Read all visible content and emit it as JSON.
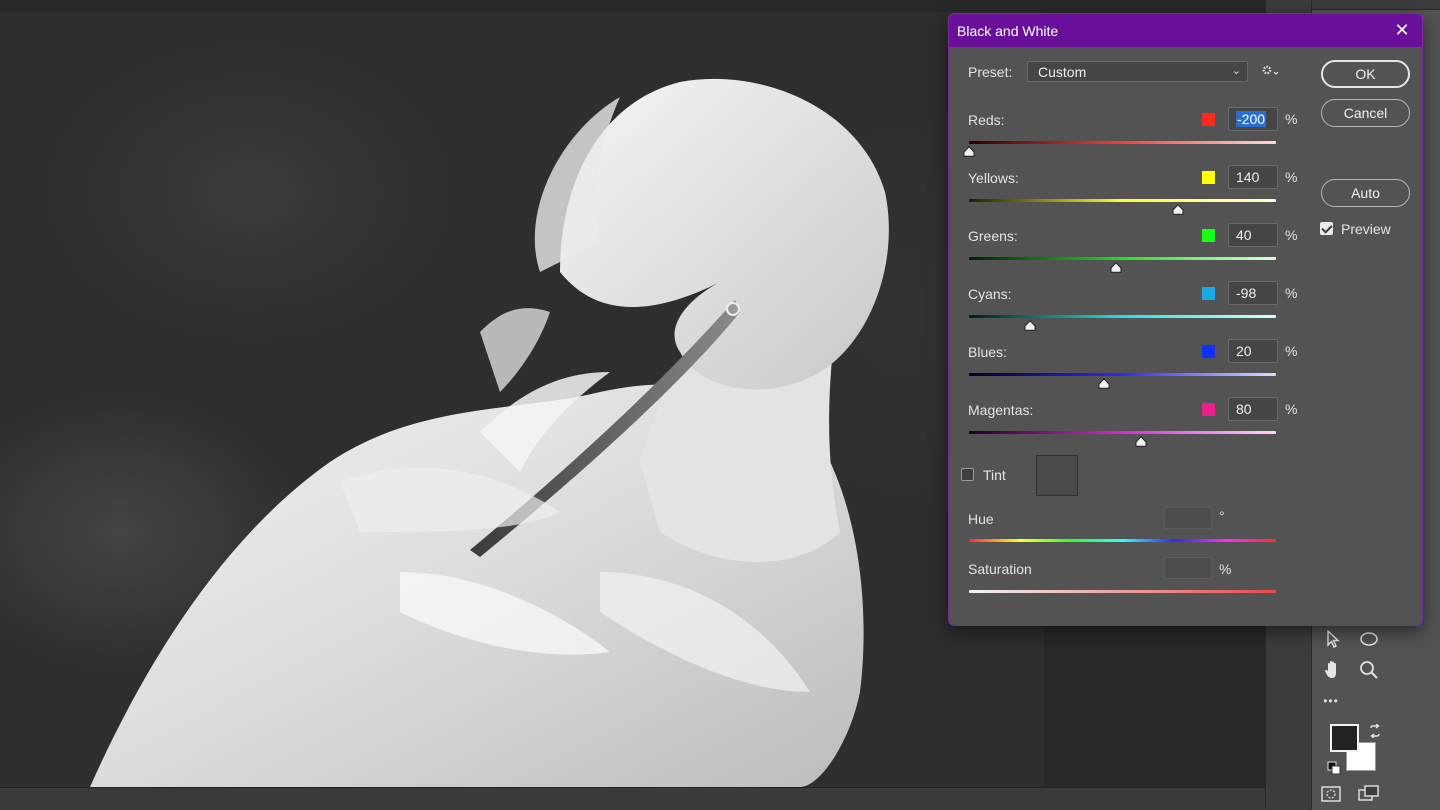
{
  "dialog": {
    "title": "Black and White",
    "close_glyph": "✕",
    "preset_label": "Preset:",
    "preset_value": "Custom",
    "buttons": {
      "ok": "OK",
      "cancel": "Cancel",
      "auto": "Auto"
    },
    "preview_label": "Preview",
    "preview_checked": true,
    "sliders": [
      {
        "label": "Reds:",
        "value": "-200",
        "unit": "%",
        "color": "#ff2a1e",
        "gradient": [
          "#2a0000",
          "#ff3b3b",
          "#ffdada"
        ],
        "level": 0.0
      },
      {
        "label": "Yellows:",
        "value": "140",
        "unit": "%",
        "color": "#ffff00",
        "gradient": [
          "#1e1e00",
          "#ffff2a",
          "#ffffd8"
        ],
        "level": 0.68
      },
      {
        "label": "Greens:",
        "value": "40",
        "unit": "%",
        "color": "#18ff18",
        "gradient": [
          "#001e00",
          "#22e022",
          "#d8ffd8"
        ],
        "level": 0.48
      },
      {
        "label": "Cyans:",
        "value": "-98",
        "unit": "%",
        "color": "#1aa8e6",
        "gradient": [
          "#001e1e",
          "#22e0e0",
          "#d8ffff"
        ],
        "level": 0.2
      },
      {
        "label": "Blues:",
        "value": "20",
        "unit": "%",
        "color": "#1030ff",
        "gradient": [
          "#00001e",
          "#2a2aff",
          "#dadaff"
        ],
        "level": 0.44
      },
      {
        "label": "Magentas:",
        "value": "80",
        "unit": "%",
        "color": "#ee1e8a",
        "gradient": [
          "#1e001e",
          "#e022e0",
          "#ffd8ff"
        ],
        "level": 0.56
      }
    ],
    "tint_label": "Tint",
    "tint_checked": false,
    "hue_label": "Hue",
    "hue_unit": "°",
    "saturation_label": "Saturation",
    "saturation_unit": "%"
  },
  "toolbar": {
    "icons": [
      "arrow-select-icon",
      "ellipse-icon",
      "hand-icon",
      "zoom-icon",
      "more-icon",
      "swap-colors-icon",
      "default-colors-icon",
      "quick-mask-icon",
      "screen-mode-icon"
    ],
    "more_glyph": "•••"
  },
  "colors": {
    "title_bar": "#6a0f9a",
    "dialog_bg": "#535353",
    "selection": "#2a6fd0"
  }
}
